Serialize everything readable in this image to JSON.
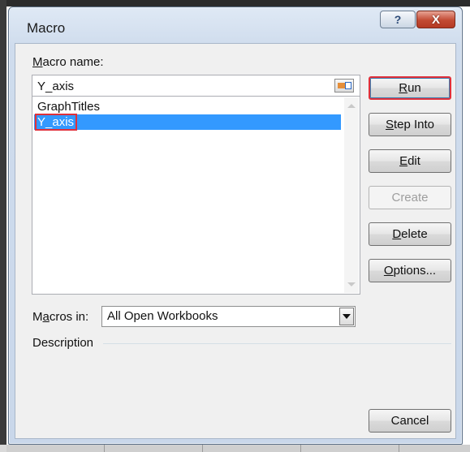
{
  "dialog": {
    "title": "Macro"
  },
  "titlebar": {
    "help_glyph": "?",
    "close_glyph": "X"
  },
  "macro_name": {
    "label_prefix": "M",
    "label_rest": "acro name:",
    "value": "Y_axis"
  },
  "macro_list": [
    {
      "label": "GraphTitles",
      "selected": false
    },
    {
      "label": "Y_axis",
      "selected": true
    }
  ],
  "buttons": {
    "run": {
      "accel": "R",
      "rest": "un"
    },
    "step_into": {
      "accel": "S",
      "rest": "tep Into"
    },
    "edit": {
      "accel": "E",
      "rest": "dit"
    },
    "create": {
      "label": "Create",
      "disabled": true
    },
    "delete": {
      "accel": "D",
      "rest": "elete"
    },
    "options": {
      "accel": "O",
      "rest": "ptions..."
    },
    "cancel": {
      "label": "Cancel"
    }
  },
  "macros_in": {
    "label_pre": "M",
    "label_accel": "a",
    "label_post": "cros in:",
    "selected": "All Open Workbooks"
  },
  "description": {
    "label": "Description"
  },
  "colors": {
    "selection": "#3399ff",
    "highlight": "#e0303a"
  },
  "icons": [
    "help-icon",
    "close-icon",
    "collapse-dialog-icon",
    "scroll-up-icon",
    "scroll-down-icon",
    "dropdown-arrow-icon"
  ]
}
